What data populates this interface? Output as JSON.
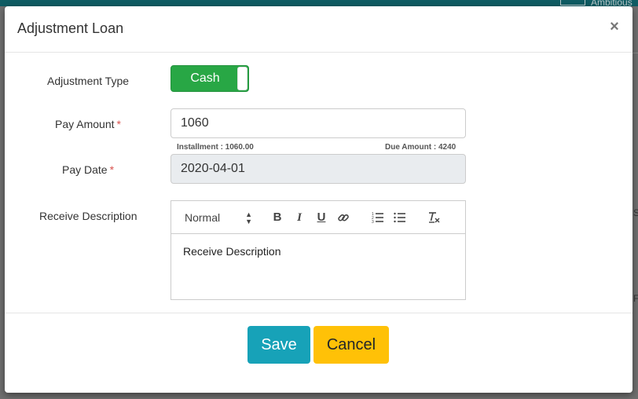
{
  "background": {
    "topbar_text": "Ambitious",
    "right_edge_letters": [
      "S",
      "F"
    ]
  },
  "modal": {
    "title": "Adjustment Loan",
    "close_glyph": "×"
  },
  "form": {
    "adjustment_type": {
      "label": "Adjustment Type",
      "toggle_value": "Cash",
      "toggle_on": true,
      "color": "#28a745"
    },
    "pay_amount": {
      "label": "Pay Amount",
      "required_mark": "*",
      "value": "1060"
    },
    "installment_note": "Installment : 1060.00",
    "due_amount_note": "Due Amount : 4240",
    "pay_date": {
      "label": "Pay Date",
      "required_mark": "*",
      "value": "2020-04-01"
    },
    "receive_description": {
      "label": "Receive Description",
      "toolbar": {
        "style_select": "Normal",
        "icons": [
          "bold-icon",
          "italic-icon",
          "underline-icon",
          "link-icon",
          "ordered-list-icon",
          "bullet-list-icon",
          "clear-format-icon"
        ]
      },
      "content": "Receive Description"
    }
  },
  "footer": {
    "save_label": "Save",
    "cancel_label": "Cancel",
    "save_color": "#17a2b8",
    "cancel_color": "#ffc107"
  }
}
